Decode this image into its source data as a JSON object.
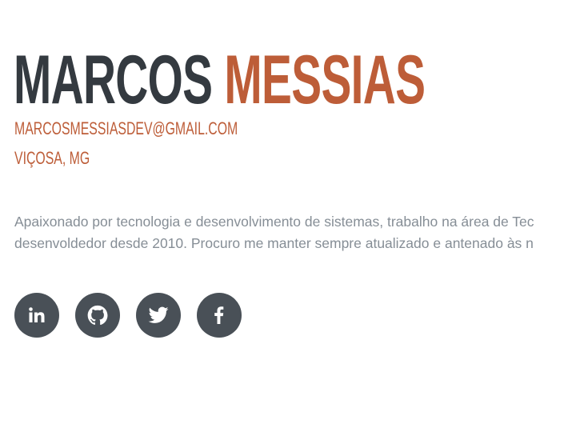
{
  "header": {
    "first_name": "MARCOS",
    "last_name": "MESSIAS",
    "email": "MARCOSMESSIASDEV@GMAIL.COM",
    "location": "VIÇOSA, MG"
  },
  "about": {
    "line1": "Apaixonado por tecnologia e desenvolvimento de sistemas, trabalho na área de Tec",
    "line2": "desenvoldedor desde 2010. Procuro me manter sempre atualizado e antenado às n"
  },
  "social": [
    {
      "icon": "linkedin-icon"
    },
    {
      "icon": "github-icon"
    },
    {
      "icon": "twitter-icon"
    },
    {
      "icon": "facebook-icon"
    }
  ],
  "colors": {
    "accent": "#bd5d38",
    "heading": "#343a40",
    "body_text": "#868e96",
    "social_bg": "#495057"
  }
}
